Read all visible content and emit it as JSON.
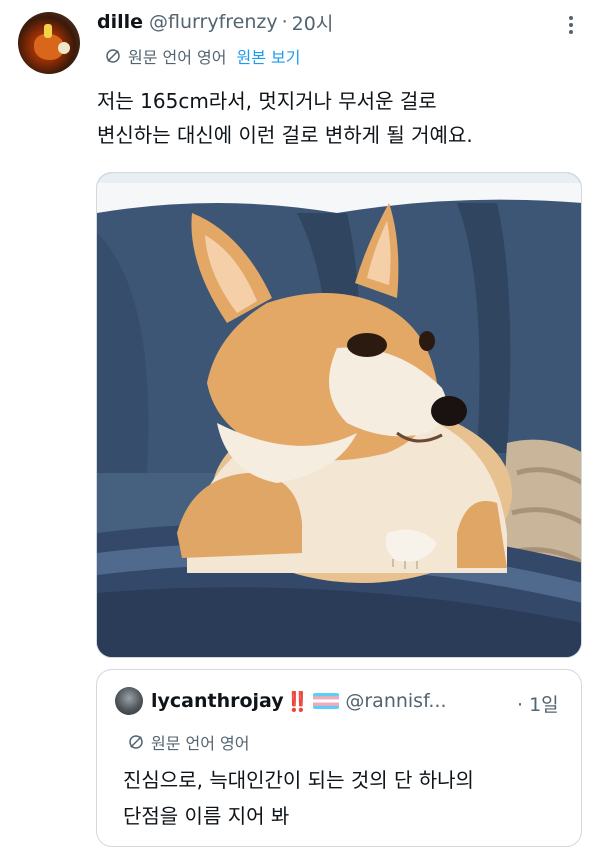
{
  "tweet": {
    "author_name": "dille",
    "author_handle": "@flurryfrenzy",
    "separator": "·",
    "time": "20시",
    "translate_label": "원문 언어 영어",
    "view_original": "원본 보기",
    "text_lines": [
      "저는 165cm라서, 멋지거나 무서운 걸로",
      "변신하는 대신에 이런 걸로 변하게 될 거예요."
    ]
  },
  "quote": {
    "author_name": "lycanthrojay",
    "badge": "‼️",
    "author_handle": "@rannisf...",
    "separator": "·",
    "time": "1일",
    "translate_label": "원문 언어 영어",
    "text_lines": [
      "진심으로, 늑대인간이 되는 것의 단 하나의",
      "단점을 이름 지어 봐"
    ]
  },
  "icons": {
    "more": "more-dots-icon",
    "translate": "translate-icon",
    "flag": "transgender-flag-icon"
  },
  "colors": {
    "link": "#1d9bf0",
    "secondary_text": "#536471",
    "border": "#cfd9de",
    "sofa": "#3f5878",
    "dog_fur": "#e0a665"
  }
}
